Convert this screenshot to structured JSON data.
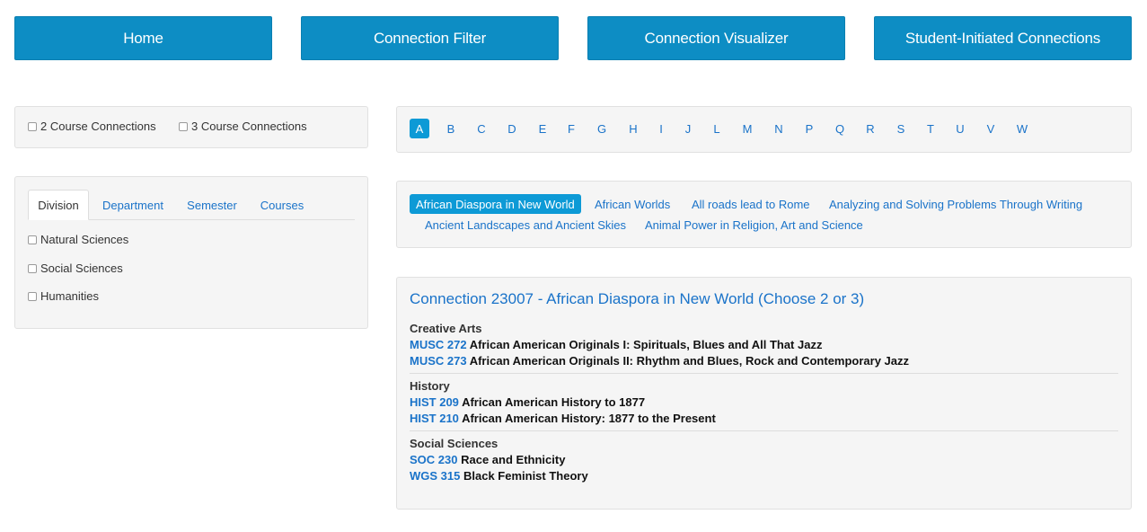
{
  "nav": {
    "home": "Home",
    "filter": "Connection Filter",
    "visualizer": "Connection Visualizer",
    "student": "Student-Initiated Connections"
  },
  "course_count": {
    "two": "2 Course Connections",
    "three": "3 Course Connections"
  },
  "filter_tabs": {
    "division": "Division",
    "department": "Department",
    "semester": "Semester",
    "courses": "Courses"
  },
  "divisions": {
    "natural": "Natural Sciences",
    "social": "Social Sciences",
    "humanities": "Humanities"
  },
  "letters": [
    "A",
    "B",
    "C",
    "D",
    "E",
    "F",
    "G",
    "H",
    "I",
    "J",
    "L",
    "M",
    "N",
    "P",
    "Q",
    "R",
    "S",
    "T",
    "U",
    "V",
    "W"
  ],
  "active_letter": "A",
  "connections_list": {
    "item0": "African Diaspora in New World",
    "item1": "African Worlds",
    "item2": "All roads lead to Rome",
    "item3": "Analyzing and Solving Problems Through Writing",
    "item4": "Ancient Landscapes and Ancient Skies",
    "item5": "Animal Power in Religion, Art and Science"
  },
  "connection": {
    "title": "Connection 23007 - African Diaspora in New World (Choose 2 or 3)",
    "groups": [
      {
        "name": "Creative Arts",
        "courses": [
          {
            "code": "MUSC 272",
            "title": "African American Originals I: Spirituals, Blues and All That Jazz"
          },
          {
            "code": "MUSC 273",
            "title": "African American Originals II: Rhythm and Blues, Rock and Contemporary Jazz"
          }
        ]
      },
      {
        "name": "History",
        "courses": [
          {
            "code": "HIST 209",
            "title": "African American History to 1877"
          },
          {
            "code": "HIST 210",
            "title": "African American History: 1877 to the Present"
          }
        ]
      },
      {
        "name": "Social Sciences",
        "courses": [
          {
            "code": "SOC 230",
            "title": "Race and Ethnicity"
          },
          {
            "code": "WGS 315",
            "title": "Black Feminist Theory"
          }
        ]
      }
    ]
  },
  "colors": {
    "nav_bg": "#0d8dc4",
    "accent": "#0d9ad6",
    "link": "#1a73c9",
    "panel_bg": "#f5f5f5"
  }
}
